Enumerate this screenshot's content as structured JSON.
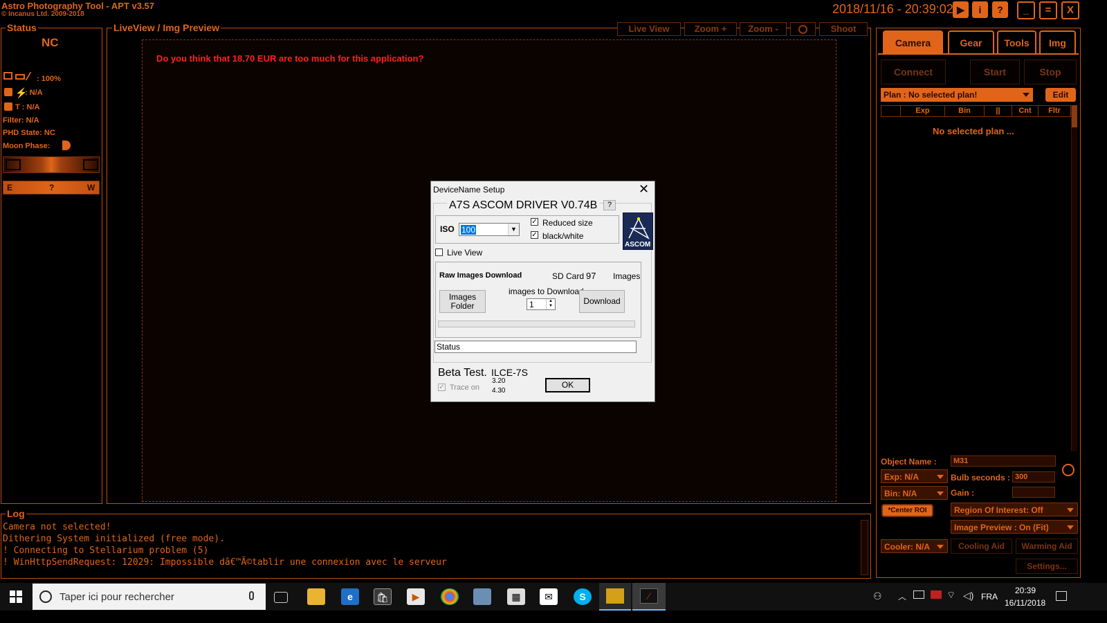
{
  "app": {
    "title": "Astro Photography Tool  -  APT v3.57",
    "copyright": "© Incanus Ltd. 2009-2018",
    "clock": "2018/11/16 - 20:39:02",
    "top_buttons": [
      "▶",
      "i",
      "?",
      "_",
      "=",
      "X"
    ]
  },
  "status_panel": {
    "legend": "Status",
    "connection": "NC",
    "battery": ": 100%",
    "temp1": ": N/A",
    "temp2": "T :  N/A",
    "filter": "Filter: N/A",
    "phd": "PHD State: NC",
    "moon": "Moon Phase:",
    "compass": {
      "e": "E",
      "q": "?",
      "w": "W"
    }
  },
  "preview": {
    "legend": "LiveView / Img Preview",
    "buttons": [
      "Live View",
      "Zoom +",
      "Zoom -",
      "Shoot"
    ],
    "message": "Do you think that 18.70 EUR are too much for this application?"
  },
  "tabs": [
    "Camera",
    "Gear",
    "Tools",
    "Img"
  ],
  "camera": {
    "connect": "Connect",
    "start": "Start",
    "stop": "Stop",
    "plan": "Plan : No selected plan!",
    "edit": "Edit",
    "columns": [
      "Exp",
      "Bin",
      "||",
      "Cnt",
      "Fltr"
    ],
    "empty": "No selected plan ...",
    "object_label": "Object Name :",
    "object_value": "M31",
    "exp": "Exp: N/A",
    "bin": "Bin: N/A",
    "bulb_label": "Bulb seconds :",
    "bulb_value": "300",
    "gain_label": "Gain :",
    "center_roi": "*Center ROI",
    "roi": "Region Of Interest: Off",
    "image_preview": "Image Preview : On (Fit)",
    "cooler": "Cooler: N/A",
    "cooling_aid": "Cooling Aid",
    "warming_aid": "Warming Aid",
    "settings": "Settings..."
  },
  "log": {
    "legend": "Log",
    "lines": [
      "  Camera not selected!",
      "  Dithering System initialized (free mode).",
      "! Connecting to Stellarium problem (5)",
      "! WinHttpSendRequest: 12029: Impossible dâ€™Ã©tablir une connexion avec le serveur"
    ]
  },
  "dialog": {
    "title": "DeviceName Setup",
    "group": "A7S ASCOM DRIVER V0.74B",
    "help": "?",
    "iso_label": "ISO",
    "iso_value": "100",
    "reduced": "Reduced size",
    "bw": "black/white",
    "live_view": "Live View",
    "raw_dl": "Raw Images Download",
    "sd_card": "SD Card",
    "sd_count": "97",
    "images": "Images",
    "images_to_dl": "images to Download",
    "dl_count": "1",
    "images_folder": "Images\nFolder",
    "download": "Download",
    "status": "Status",
    "beta": "Beta Test.",
    "model": "ILCE-7S",
    "trace": "Trace on",
    "v1": "3.20",
    "v2": "4.30",
    "ok": "OK",
    "ascom": "ASCOM"
  },
  "taskbar": {
    "search": "Taper ici pour rechercher",
    "lang": "FRA",
    "time": "20:39",
    "date": "16/11/2018"
  }
}
